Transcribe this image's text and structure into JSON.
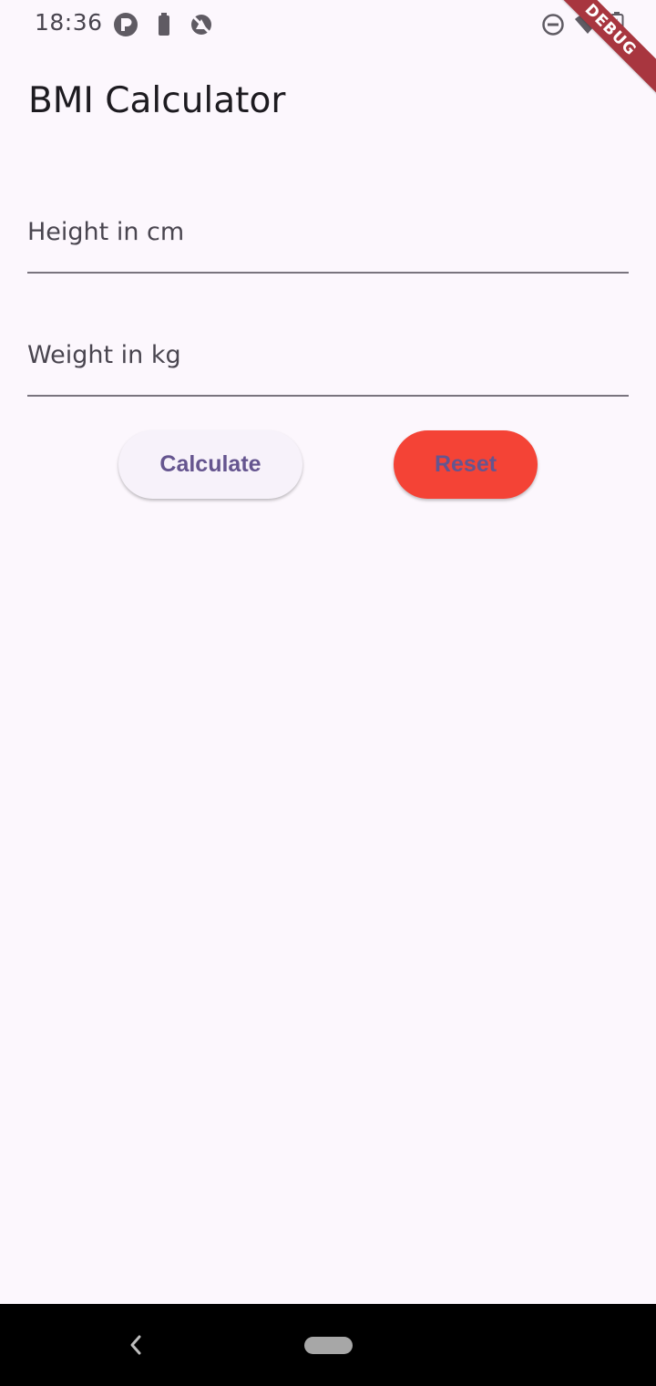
{
  "status_bar": {
    "time": "18:36",
    "icons": [
      "app-p-icon",
      "battery-icon",
      "no-signal-icon",
      "dnd-icon",
      "wifi-icon",
      "battery-charging-icon"
    ]
  },
  "debug_banner": "DEBUG",
  "app_bar": {
    "title": "BMI Calculator"
  },
  "form": {
    "height_placeholder": "Height in cm",
    "height_value": "",
    "weight_placeholder": "Weight in kg",
    "weight_value": ""
  },
  "buttons": {
    "calculate_label": "Calculate",
    "reset_label": "Reset"
  },
  "colors": {
    "background": "#FCF7FD",
    "primary_text": "#65558F",
    "reset_button": "#F44336",
    "calculate_button": "#F7F2FA"
  },
  "nav_bar": {
    "icons": [
      "back-icon",
      "home-pill-icon"
    ]
  }
}
